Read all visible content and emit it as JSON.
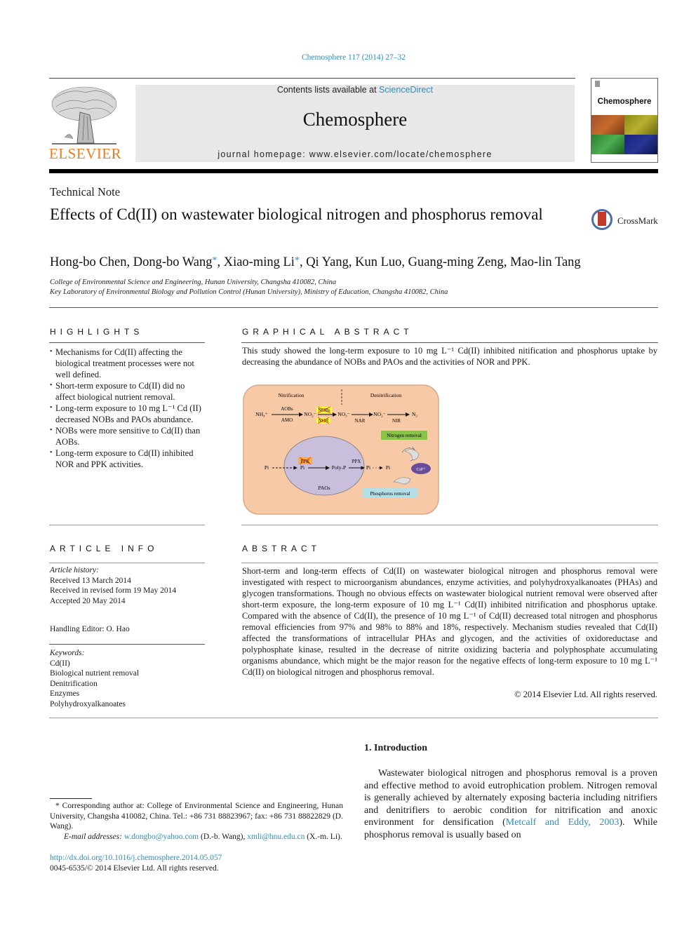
{
  "header": {
    "journal_ref": "Chemosphere 117 (2014) 27–32",
    "contents_prefix": "Contents lists available at ",
    "contents_link": "ScienceDirect",
    "journal_title": "Chemosphere",
    "homepage": "journal homepage: www.elsevier.com/locate/chemosphere",
    "publisher_logo": "ELSEVIER",
    "cover_title": "Chemosphere",
    "colors": {
      "publisher_orange": "#f07c1e",
      "link_blue": "#2a8fc4",
      "banner_grey": "#e8e8e8"
    }
  },
  "article": {
    "type": "Technical Note",
    "title": "Effects of Cd(II) on wastewater biological nitrogen and phosphorus removal",
    "crossmark_label": "CrossMark",
    "authors": [
      {
        "name": "Hong-bo Chen",
        "corresponding": false
      },
      {
        "name": "Dong-bo Wang",
        "corresponding": true
      },
      {
        "name": "Xiao-ming Li",
        "corresponding": true
      },
      {
        "name": "Qi Yang",
        "corresponding": false
      },
      {
        "name": "Kun Luo",
        "corresponding": false
      },
      {
        "name": "Guang-ming Zeng",
        "corresponding": false
      },
      {
        "name": "Mao-lin Tang",
        "corresponding": false
      }
    ],
    "affiliations": [
      "College of Environmental Science and Engineering, Hunan University, Changsha 410082, China",
      "Key Laboratory of Environmental Biology and Pollution Control (Hunan University), Ministry of Education, Changsha 410082, China"
    ]
  },
  "highlights": {
    "heading": "HIGHLIGHTS",
    "items": [
      "Mechanisms for Cd(II) affecting the biological treatment processes were not well defined.",
      "Short-term exposure to Cd(II) did no affect biological nutrient removal.",
      "Long-term exposure to 10 mg L⁻¹ Cd (II) decreased NOBs and PAOs abundance.",
      "NOBs were more sensitive to Cd(II) than AOBs.",
      "Long-term exposure to Cd(II) inhibited NOR and PPK activities."
    ]
  },
  "graphical_abstract": {
    "heading": "GRAPHICAL ABSTRACT",
    "text": "This study showed the long-term exposure to 10 mg L⁻¹ Cd(II) inhibited nitification and phosphorus uptake by decreasing the abundance of NOBs and PAOs and the activities of NOR and PPK.",
    "figure": {
      "nitrification_label": "Nitrification",
      "denitrification_label": "Denitrification",
      "nh4": "NH₄⁺",
      "aobs": "AOBs",
      "amo": "AMO",
      "no2_a": "NO₂⁻",
      "nobs": "NOBs",
      "nor": "NOR",
      "no3": "NO₃⁻",
      "nar": "NAR",
      "no2_b": "NO₂⁻",
      "nir": "NIR",
      "n2": "N₂",
      "nitrogen_removal": "Nitrogen removal",
      "pi_out": "Pi",
      "pi_in": "Pi",
      "ppk": "PPK",
      "polyp": "Poly-P",
      "ppx": "PPX",
      "pi_release": "Pi",
      "pi_final": "Pi",
      "paos": "PAOs",
      "cd": "Cd²⁺",
      "phosphorus_removal": "Phosphorus removal"
    }
  },
  "article_info": {
    "heading": "ARTICLE INFO",
    "history_label": "Article history:",
    "history": [
      "Received 13 March 2014",
      "Received in revised form 19 May 2014",
      "Accepted 20 May 2014"
    ],
    "editor": "Handling Editor: O. Hao",
    "keywords_label": "Keywords:",
    "keywords": [
      "Cd(II)",
      "Biological nutrient removal",
      "Denitrification",
      "Enzymes",
      "Polyhydroxyalkanoates"
    ]
  },
  "abstract": {
    "heading": "ABSTRACT",
    "text": "Short-term and long-term effects of Cd(II) on wastewater biological nitrogen and phosphorus removal were investigated with respect to microorganism abundances, enzyme activities, and polyhydroxyalkanoates (PHAs) and glycogen transformations. Though no obvious effects on wastewater biological nutrient removal were observed after short-term exposure, the long-term exposure of 10 mg L⁻¹ Cd(II) inhibited nitrification and phosphorus uptake. Compared with the absence of Cd(II), the presence of 10 mg L⁻¹ of Cd(II) decreased total nitrogen and phosphorus removal efficiencies from 97% and 98% to 88% and 18%, respectively. Mechanism studies revealed that Cd(II) affected the transformations of intracellular PHAs and glycogen, and the activities of oxidoreductase and polyphosphate kinase, resulted in the decrease of nitrite oxidizing bacteria and polyphosphate accumulating organisms abundance, which might be the major reason for the negative effects of long-term exposure to 10 mg L⁻¹ Cd(II) on biological nitrogen and phosphorus removal.",
    "copyright": "© 2014 Elsevier Ltd. All rights reserved."
  },
  "introduction": {
    "heading": "1. Introduction",
    "text_before_link": "Wastewater biological nitrogen and phosphorus removal is a proven and effective method to avoid eutrophication problem. Nitrogen removal is generally achieved by alternately exposing bacteria including nitrifiers and denitrifiers to aerobic condition for nitrification and anoxic environment for densification (",
    "citation": "Metcalf and Eddy, 2003",
    "text_after_link": "). While phosphorus removal is usually based on"
  },
  "footnotes": {
    "corresponding": "* Corresponding author at: College of Environmental Science and Engineering, Hunan University, Changsha 410082, China. Tel.: +86 731 88823967; fax: +86 731 88822829 (D. Wang).",
    "email_label": "E-mail addresses:",
    "email1": "w.dongbo@yahoo.com",
    "email1_owner": " (D.-b. Wang),",
    "email2": "xmli@hnu.edu.cn",
    "email2_owner": " (X.-m. Li).",
    "doi": "http://dx.doi.org/10.1016/j.chemosphere.2014.05.057",
    "issn": "0045-6535/© 2014 Elsevier Ltd. All rights reserved."
  }
}
